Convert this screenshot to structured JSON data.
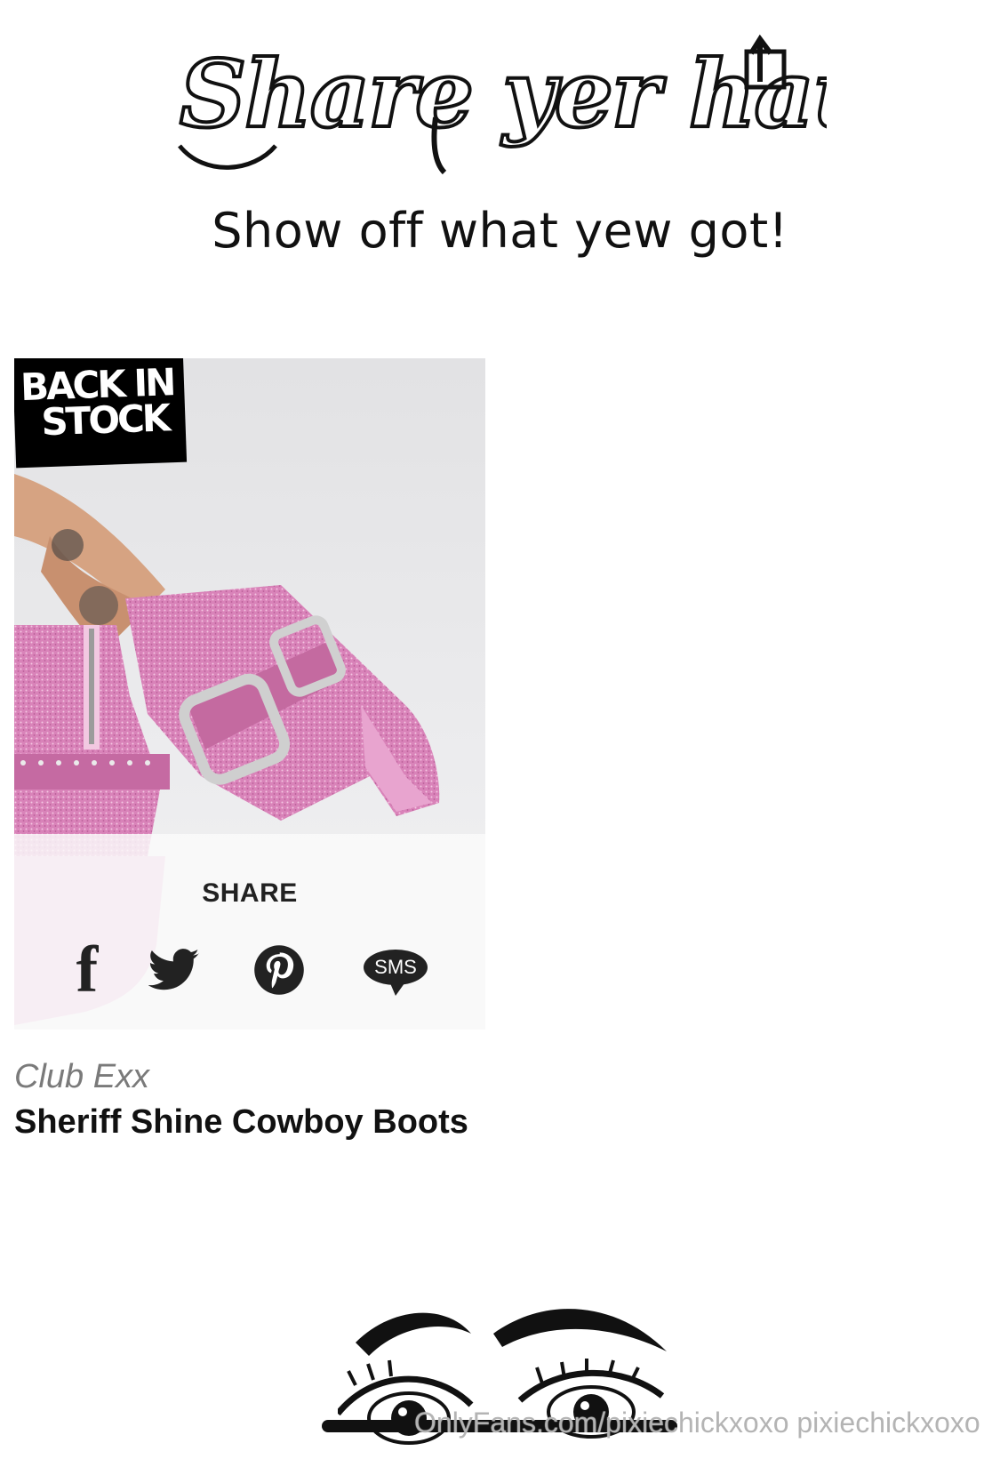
{
  "header": {
    "logo_text": "Share yer haul",
    "tagline": "Show off what yew got!"
  },
  "product": {
    "badge_line1": "BACK IN",
    "badge_line2": "STOCK",
    "share_label": "SHARE",
    "share_icons": [
      "facebook-icon",
      "twitter-icon",
      "pinterest-icon",
      "sms-icon"
    ],
    "sms_label": "SMS",
    "brand": "Club Exx",
    "name": "Sheriff Shine Cowboy Boots",
    "image_subject": "pink-rhinestone-cowboy-boots"
  },
  "footer": {
    "watermark": "OnlyFans.com/pixiechickxoxo pixiechickxoxo"
  },
  "colors": {
    "text": "#111111",
    "brand_gray": "#7a7a7a",
    "boot_pink": "#d77fb6",
    "share_overlay": "#fafafa"
  }
}
